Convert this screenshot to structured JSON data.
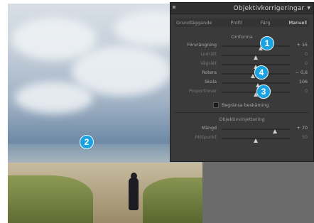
{
  "panel": {
    "title": "Objektivkorrigeringar",
    "tabs": [
      {
        "label": "Grundläggande",
        "active": false
      },
      {
        "label": "Profil",
        "active": false
      },
      {
        "label": "Färg",
        "active": false
      },
      {
        "label": "Manuell",
        "active": true
      }
    ],
    "transform": {
      "section_title": "Omforma",
      "sliders": [
        {
          "label": "Förvrängning",
          "value": "+ 15",
          "position": 0.57
        },
        {
          "label": "Lodrätt",
          "value": "0",
          "position": 0.5
        },
        {
          "label": "Vågrätt",
          "value": "0",
          "position": 0.5
        },
        {
          "label": "Rotera",
          "value": "− 0,6",
          "position": 0.46
        },
        {
          "label": "Skala",
          "value": "106",
          "position": 0.53
        },
        {
          "label": "Proportioner",
          "value": "0",
          "position": 0.5
        }
      ],
      "checkbox_label": "Begränsa beskärning",
      "checkbox_checked": false
    },
    "vignetting": {
      "section_title": "Objektivvinjettering",
      "sliders": [
        {
          "label": "Mängd",
          "value": "+ 70",
          "position": 0.78
        },
        {
          "label": "Mittpunkt",
          "value": "50",
          "position": 0.5
        }
      ]
    }
  },
  "badges": [
    "1",
    "2",
    "3",
    "4"
  ]
}
